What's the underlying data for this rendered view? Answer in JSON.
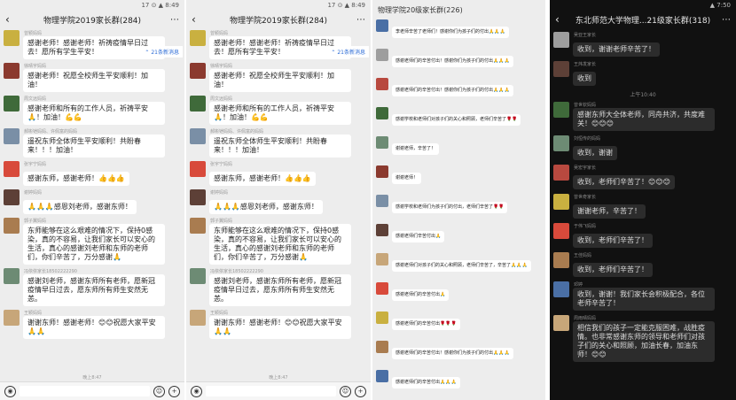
{
  "panels": [
    {
      "status": "17 ⊙ ▲ 8:49",
      "title": "物理学院2019家长群(284)",
      "new_messages": "21条新消息",
      "messages": [
        {
          "sender": "曾颖妈妈",
          "text": "感谢老师！感谢老师！祈祷疫情早日过去！愿所有学生平安！"
        },
        {
          "sender": "徐晴宇妈妈",
          "text": "感谢老师！祝愿全校师生平安顺利！加油！"
        },
        {
          "sender": "周文远妈妈",
          "text": "感谢老师和所有的工作人员，祈祷平安🙏！加油！💪💪"
        },
        {
          "sender": "郝彬铠妈妈、许佩富的妈妈",
          "text": "遥祝东师全体师生平安顺利！共盼春来！！！加油！"
        },
        {
          "sender": "张宇宁妈妈",
          "text": "感谢东师，感谢老师！👍👍👍"
        },
        {
          "sender": "谢婷妈妈",
          "text": "🙏🙏🙏感恩刘老师，感谢东师！"
        },
        {
          "sender": "郭子翼妈妈",
          "text": "东师能够在这么艰难的情况下，保持0感染，真的不容易，让我们家长可以安心的生活，真心的感谢刘老师和东师的老师们，你们辛苦了，万分感谢🙏"
        },
        {
          "sender": "冯依依家长18502222290",
          "text": "感谢刘老师，感谢东师所有老师，愿新冠疫情早日过去，愿东师所有师生安然无恙。"
        },
        {
          "sender": "王颖妈妈",
          "text": "谢谢东师！感谢老师！😊😊祝愿大家平安🙏🙏"
        }
      ],
      "footer": "晚上8:47"
    },
    {
      "status": "17 ⊙ ▲ 8:49",
      "title": "物理学院2019家长群(284)",
      "new_messages": "21条新消息",
      "messages": [
        {
          "sender": "曾颖妈妈",
          "text": "感谢老师！感谢老师！祈祷疫情早日过去！愿所有学生平安！"
        },
        {
          "sender": "徐晴宇妈妈",
          "text": "感谢老师！祝愿全校师生平安顺利！加油！"
        },
        {
          "sender": "周文远妈妈",
          "text": "感谢老师和所有的工作人员，祈祷平安🙏！加油！💪💪"
        },
        {
          "sender": "郝彬铠妈妈、许佩富的妈妈",
          "text": "遥祝东师全体师生平安顺利！共盼春来！！！加油！"
        },
        {
          "sender": "张宇宁妈妈",
          "text": "感谢东师，感谢老师！👍👍👍"
        },
        {
          "sender": "谢婷妈妈",
          "text": "🙏🙏🙏感恩刘老师，感谢东师！"
        },
        {
          "sender": "郭子翼妈妈",
          "text": "东师能够在这么艰难的情况下，保持0感染，真的不容易，让我们家长可以安心的生活，真心的感谢刘老师和东师的老师们，你们辛苦了，万分感谢🙏"
        },
        {
          "sender": "冯依依家长18502222290",
          "text": "感谢刘老师，感谢东师所有老师，愿新冠疫情早日过去，愿东师所有师生安然无恙。"
        },
        {
          "sender": "王颖妈妈",
          "text": "谢谢东师！感谢老师！😊😊祝愿大家平安🙏🙏"
        }
      ],
      "footer": "晚上8:47"
    },
    {
      "title": "物理学院20级家长群(226)",
      "messages": [
        {
          "sender": "",
          "text": "李老师辛苦了老师们！感谢你们为孩子们的付出🙏🙏🙏"
        },
        {
          "sender": "",
          "text": "感谢老师们的辛苦付出！感谢你们为孩子们的付出🙏🙏🙏"
        },
        {
          "sender": "",
          "text": "感谢老师们的辛苦付出！感谢你们为孩子们的付出🙏🙏🙏"
        },
        {
          "sender": "",
          "text": "感谢学校和老师们对孩子们的关心和照顾，老师们辛苦了🌹🌹"
        },
        {
          "sender": "",
          "text": "谢谢老师，辛苦了！"
        },
        {
          "sender": "",
          "text": "谢谢老师！"
        },
        {
          "sender": "",
          "text": "感谢学校和老师们为孩子们的付出，老师们辛苦了🌹🌹"
        },
        {
          "sender": "",
          "text": "感谢老师们辛苦付出🙏"
        },
        {
          "sender": "",
          "text": "感谢老师们对孩子们的关心和照顾，老师们辛苦了，辛苦了🙏🙏🙏"
        },
        {
          "sender": "",
          "text": "感谢老师们的辛苦付出🙏"
        },
        {
          "sender": "",
          "text": "感谢老师们的辛苦付出🌹🌹🌹"
        },
        {
          "sender": "",
          "text": "感谢老师们的辛苦付出！感谢你们为孩子们的付出🙏🙏🙏"
        },
        {
          "sender": "",
          "text": "感谢老师们的辛苦付出🙏🙏🙏"
        }
      ]
    },
    {
      "status": "▲ 7:50",
      "title": "东北师范大学物理...21级家长群(318)",
      "time_separator": "上午10:40",
      "messages": [
        {
          "sender": "吴亚王家长",
          "text": "收到，谢谢老师辛苦了！"
        },
        {
          "sender": "王炜发家长",
          "text": "收到"
        },
        {
          "sender": "曾世钦妈妈",
          "text": "感谢东师大全体老师，同舟共济，共度难关！😊😊😊"
        },
        {
          "sender": "刘恒传的妈妈",
          "text": "收到，谢谢"
        },
        {
          "sender": "吴宏宇家长",
          "text": "收到，老师们辛苦了！😊😊😊"
        },
        {
          "sender": "曾世奇家长",
          "text": "谢谢老师，辛苦了！"
        },
        {
          "sender": "于伟飞妈妈",
          "text": "收到，老师们辛苦了！"
        },
        {
          "sender": "王佳妈妈",
          "text": "收到，老师们辛苦了！"
        },
        {
          "sender": "邓婷",
          "text": "收到，谢谢！我们家长会积极配合，各位老师辛苦了！"
        },
        {
          "sender": "周雨晴妈妈",
          "text": "相信我们的孩子一定能克服困难，战胜疫情。也非常感谢东师的领导和老师们对孩子们的关心和照顾，加油长春，加油东师！😊😊"
        }
      ]
    }
  ]
}
